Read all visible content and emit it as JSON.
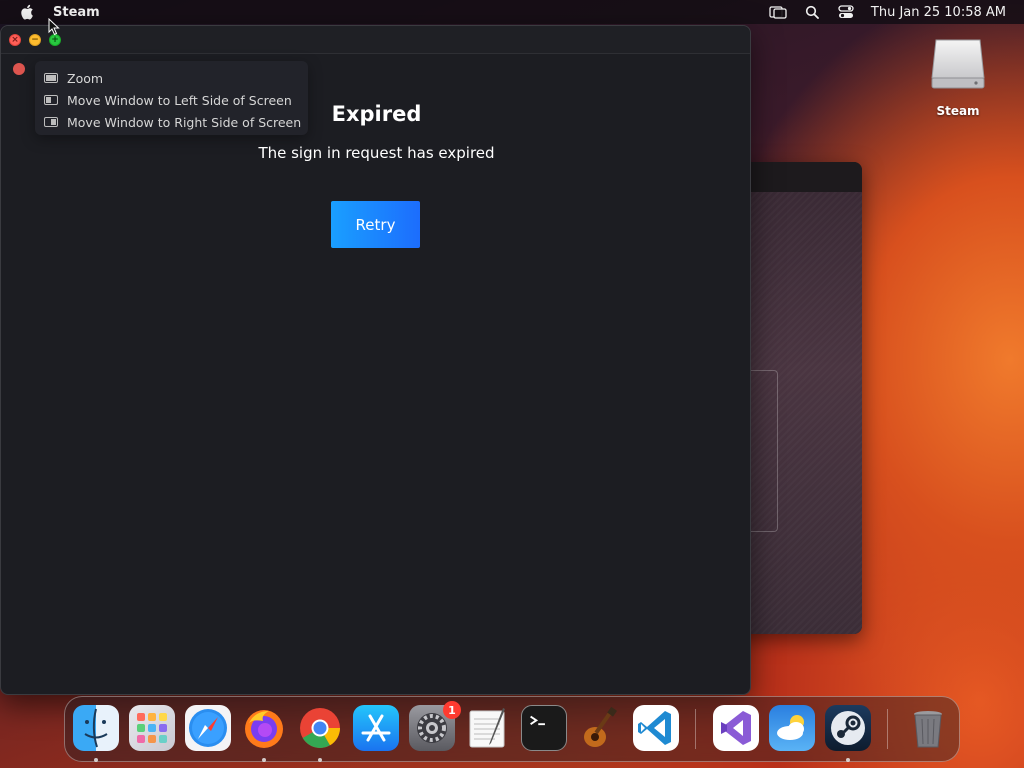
{
  "menubar": {
    "app_name": "Steam",
    "clock": "Thu Jan 25  10:58 AM",
    "icons": [
      "apple-icon",
      "screen-mirroring-icon",
      "spotlight-search-icon",
      "control-center-icon"
    ]
  },
  "desktop": {
    "drive_label": "Steam"
  },
  "window": {
    "zoom_menu": {
      "items": [
        {
          "label": "Zoom",
          "icon": "zoom-window-icon"
        },
        {
          "label": "Move Window to Left Side of Screen",
          "icon": "tile-left-icon"
        },
        {
          "label": "Move Window to Right Side of Screen",
          "icon": "tile-right-icon"
        }
      ]
    },
    "title": "Expired",
    "message": "The sign in request has expired",
    "retry_label": "Retry"
  },
  "dock": {
    "items": [
      {
        "icon": "finder-icon",
        "running": true
      },
      {
        "icon": "launchpad-icon",
        "running": false
      },
      {
        "icon": "safari-icon",
        "running": false
      },
      {
        "icon": "firefox-icon",
        "running": true
      },
      {
        "icon": "chrome-icon",
        "running": true
      },
      {
        "icon": "app-store-icon",
        "running": false
      },
      {
        "icon": "system-settings-icon",
        "running": false,
        "badge": "1"
      },
      {
        "icon": "textedit-icon",
        "running": false
      },
      {
        "icon": "terminal-icon",
        "running": false
      },
      {
        "icon": "garageband-icon",
        "running": false
      },
      {
        "icon": "vscode-icon",
        "running": false
      },
      {
        "icon": "visual-studio-icon",
        "running": false
      },
      {
        "icon": "weather-icon",
        "running": false
      },
      {
        "icon": "steam-icon",
        "running": true
      },
      {
        "icon": "trash-icon",
        "running": false
      }
    ]
  },
  "colors": {
    "retry_button": "#1a9fff",
    "window_bg": "#1c1d22",
    "badge": "#ff3b30"
  }
}
